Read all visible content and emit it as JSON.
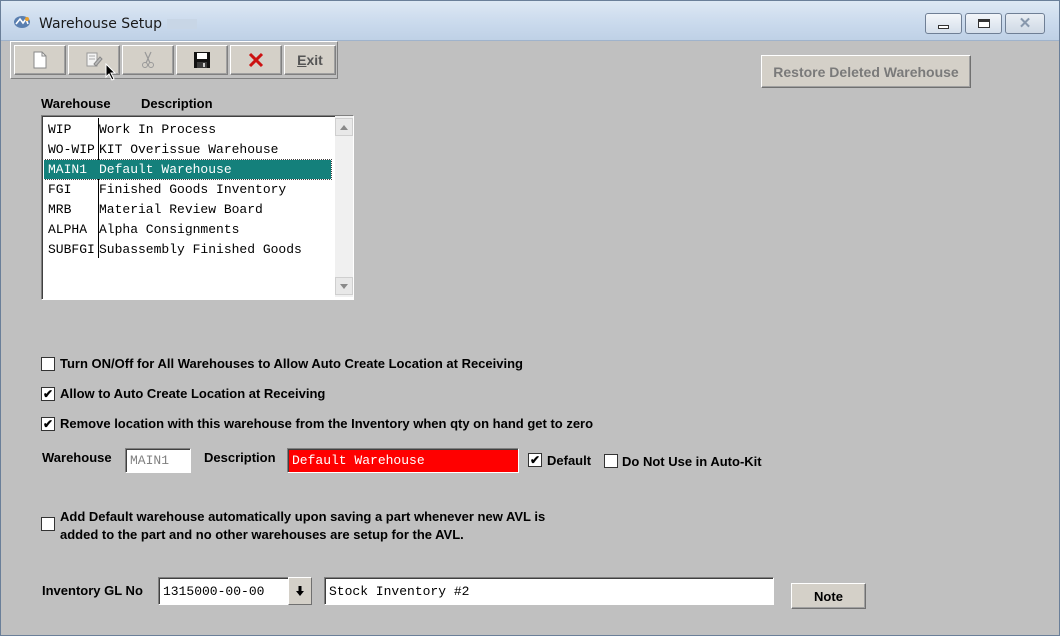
{
  "window": {
    "title": "Warehouse Setup"
  },
  "toolbar": {
    "new_icon": "new-document-icon",
    "edit_icon": "edit-icon",
    "cut_icon": "scissors-icon",
    "save_icon": "save-disk-icon",
    "delete_icon": "delete-x-icon",
    "exit_label_first": "E",
    "exit_label_rest": "xit"
  },
  "restore_button": {
    "label": "Restore Deleted Warehouse"
  },
  "list": {
    "header_warehouse": "Warehouse",
    "header_description": "Description",
    "rows": [
      {
        "code": "WIP",
        "description": "Work In Process"
      },
      {
        "code": "WO-WIP",
        "description": "KIT Overissue Warehouse"
      },
      {
        "code": "MAIN1",
        "description": "Default Warehouse"
      },
      {
        "code": "FGI",
        "description": "Finished Goods Inventory"
      },
      {
        "code": "MRB",
        "description": "Material Review Board"
      },
      {
        "code": "ALPHA",
        "description": "Alpha Consignments"
      },
      {
        "code": "SUBFGI",
        "description": "Subassembly Finished Goods"
      }
    ],
    "selected_index": 2
  },
  "options": {
    "turn_on_off_all": {
      "label": "Turn ON/Off for All Warehouses to Allow Auto Create Location at Receiving",
      "checked": false
    },
    "allow_auto_create": {
      "label": "Allow to Auto Create Location at Receiving",
      "checked": true
    },
    "remove_location": {
      "label": "Remove location with this warehouse from the Inventory when qty on hand get to zero",
      "checked": true
    }
  },
  "detail": {
    "warehouse_label": "Warehouse",
    "warehouse_value": "MAIN1",
    "description_label": "Description",
    "description_value": "Default Warehouse",
    "default_label": "Default",
    "default_checked": true,
    "no_autokit_label": "Do Not Use in Auto-Kit",
    "no_autokit_checked": false
  },
  "add_default": {
    "line1": "Add Default warehouse automatically upon saving a part whenever new AVL is",
    "line2": "added to the part and no other warehouses are setup for the AVL.",
    "checked": false
  },
  "gl": {
    "label": "Inventory GL No",
    "number": "1315000-00-00",
    "description": "Stock Inventory #2"
  },
  "note_button": {
    "label": "Note"
  },
  "colors": {
    "selection": "#14807b",
    "description_field": "#ff0000",
    "form_background": "#c0c0c0"
  }
}
